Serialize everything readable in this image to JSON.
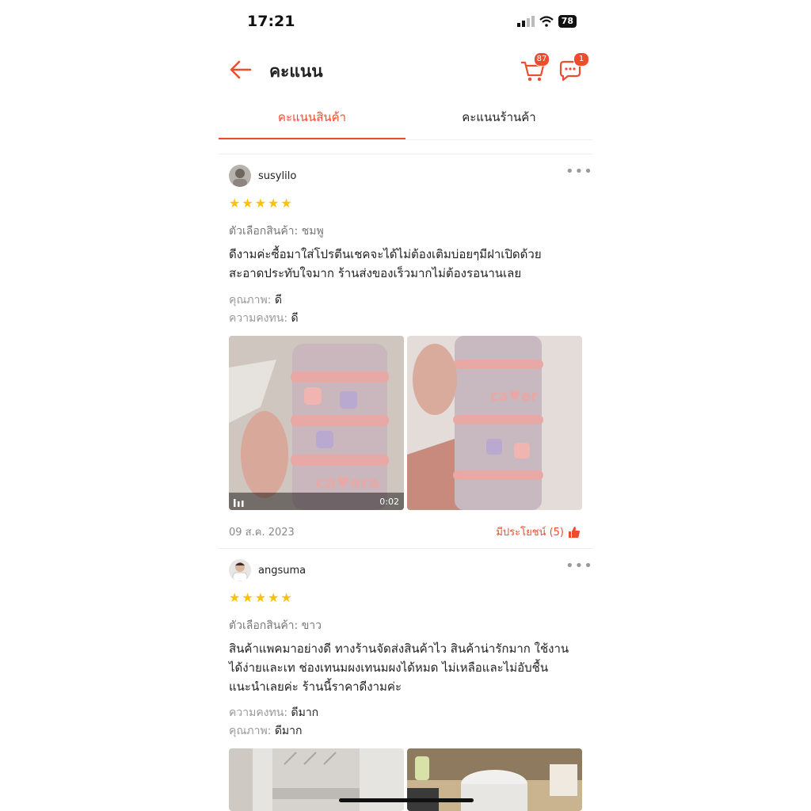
{
  "status": {
    "time": "17:21",
    "battery": "78"
  },
  "header": {
    "title": "คะแนน",
    "cart_count": "87",
    "chat_count": "1"
  },
  "tabs": [
    {
      "label": "คะแนนสินค้า",
      "active": true
    },
    {
      "label": "คะแนนร้านค้า",
      "active": false
    }
  ],
  "reviews": [
    {
      "username": "susylilo",
      "stars": 5,
      "variant": "ตัวเลือกสินค้า: ชมพู",
      "text_line1": "ดีงามค่ะซื้อมาใส่โปรตีนเชคจะได้ไม่ต้องเติมบ่อยๆมีฝาเปิดด้วย",
      "text_line2": "สะอาดประทับใจมาก ร้านส่งของเร็วมากไม่ต้องรอนานเลย",
      "attr1_label": "คุณภาพ:",
      "attr1_value": "ดี",
      "attr2_label": "ความคงทน:",
      "attr2_value": "ดี",
      "video_duration": "0:02",
      "date": "09 ส.ค. 2023",
      "helpful": "มีประโยชน์ (5)"
    },
    {
      "username": "angsuma",
      "stars": 5,
      "variant": "ตัวเลือกสินค้า: ขาว",
      "text_line1": "สินค้าแพคมาอย่างดี ทางร้านจัดส่งสินค้าไว สินค้าน่ารักมาก ใช้งาน",
      "text_line2": "ได้ง่ายและเท ช่องเทนมผงเทนมผงได้หมด ไม่เหลือและไม่อับชื้น",
      "text_line3": "แนะนำเลยค่ะ ร้านนี้ราคาดีงามค่ะ",
      "attr1_label": "ความคงทน:",
      "attr1_value": "ดีมาก",
      "attr2_label": "คุณภาพ:",
      "attr2_value": "ดีมาก"
    }
  ],
  "colors": {
    "accent": "#ee4d2d",
    "star": "#ffc107"
  }
}
